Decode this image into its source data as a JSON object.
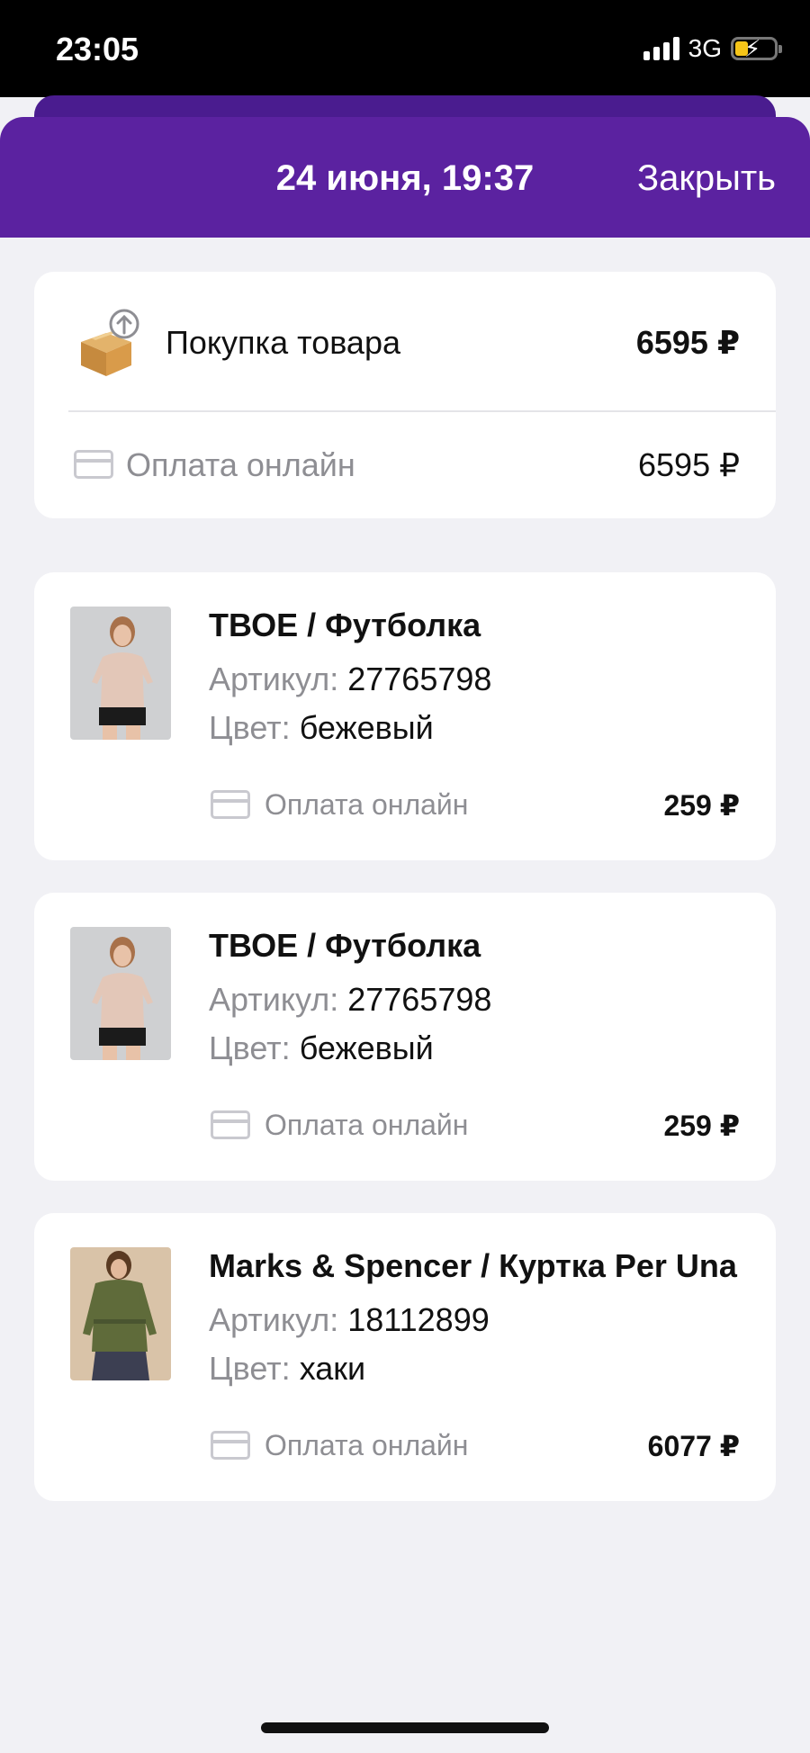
{
  "status_bar": {
    "time": "23:05",
    "network": "3G"
  },
  "header": {
    "title": "24 июня, 19:37",
    "close_label": "Закрыть"
  },
  "summary": {
    "label": "Покупка товара",
    "amount": "6595 ₽",
    "payment_label": "Оплата онлайн",
    "payment_amount": "6595 ₽"
  },
  "items": [
    {
      "title": "ТВОЕ / Футболка",
      "article_label": "Артикул:",
      "article": "27765798",
      "color_label": "Цвет:",
      "color": "бежевый",
      "payment_label": "Оплата онлайн",
      "price": "259 ₽"
    },
    {
      "title": "ТВОЕ / Футболка",
      "article_label": "Артикул:",
      "article": "27765798",
      "color_label": "Цвет:",
      "color": "бежевый",
      "payment_label": "Оплата онлайн",
      "price": "259 ₽"
    },
    {
      "title": "Marks & Spencer / Куртка Per Una",
      "article_label": "Артикул:",
      "article": "18112899",
      "color_label": "Цвет:",
      "color": "хаки",
      "payment_label": "Оплата онлайн",
      "price": "6077 ₽"
    }
  ],
  "colors": {
    "header": "#5b22a0",
    "background": "#f1f1f5",
    "muted_text": "#8e8e93"
  },
  "icons": [
    "signal-icon",
    "battery-icon",
    "box-upload-icon",
    "credit-card-icon"
  ]
}
